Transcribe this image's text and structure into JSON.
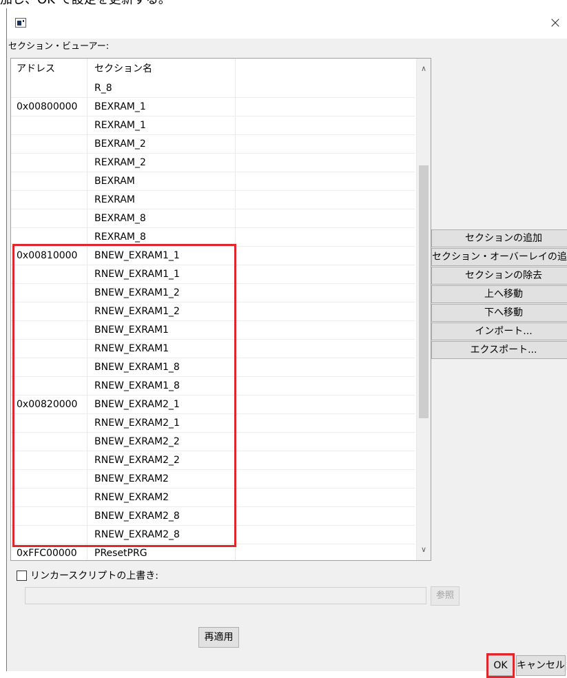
{
  "page_text": "加し、OK で設定を更新する。",
  "dialog": {
    "close_glyph": "×",
    "section_viewer_label": "セクション・ビューアー:"
  },
  "table": {
    "columns": [
      "アドレス",
      "セクション名"
    ],
    "rows": [
      {
        "address": "",
        "name": "R_8"
      },
      {
        "address": "0x00800000",
        "name": "BEXRAM_1"
      },
      {
        "address": "",
        "name": "REXRAM_1"
      },
      {
        "address": "",
        "name": "BEXRAM_2"
      },
      {
        "address": "",
        "name": "REXRAM_2"
      },
      {
        "address": "",
        "name": "BEXRAM"
      },
      {
        "address": "",
        "name": "REXRAM"
      },
      {
        "address": "",
        "name": "BEXRAM_8"
      },
      {
        "address": "",
        "name": "REXRAM_8"
      },
      {
        "address": "0x00810000",
        "name": "BNEW_EXRAM1_1"
      },
      {
        "address": "",
        "name": "RNEW_EXRAM1_1"
      },
      {
        "address": "",
        "name": "BNEW_EXRAM1_2"
      },
      {
        "address": "",
        "name": "RNEW_EXRAM1_2"
      },
      {
        "address": "",
        "name": "BNEW_EXRAM1"
      },
      {
        "address": "",
        "name": "RNEW_EXRAM1"
      },
      {
        "address": "",
        "name": "BNEW_EXRAM1_8"
      },
      {
        "address": "",
        "name": "RNEW_EXRAM1_8"
      },
      {
        "address": "0x00820000",
        "name": "BNEW_EXRAM2_1"
      },
      {
        "address": "",
        "name": "RNEW_EXRAM2_1"
      },
      {
        "address": "",
        "name": "BNEW_EXRAM2_2"
      },
      {
        "address": "",
        "name": "RNEW_EXRAM2_2"
      },
      {
        "address": "",
        "name": "BNEW_EXRAM2"
      },
      {
        "address": "",
        "name": "RNEW_EXRAM2"
      },
      {
        "address": "",
        "name": "BNEW_EXRAM2_8"
      },
      {
        "address": "",
        "name": "RNEW_EXRAM2_8"
      },
      {
        "address": "0xFFC00000",
        "name": "PResetPRG"
      }
    ],
    "scroll_up_glyph": "∧",
    "scroll_down_glyph": "∨"
  },
  "side_buttons": [
    "セクションの追加",
    "セクション・オーバーレイの追加",
    "セクションの除去",
    "上へ移動",
    "下へ移動",
    "インポート...",
    "エクスポート..."
  ],
  "linker": {
    "checkbox_label": "リンカースクリプトの上書き:",
    "checked": false,
    "path_value": "",
    "browse_label": "参照"
  },
  "buttons": {
    "reapply": "再適用",
    "ok": "OK",
    "cancel": "キャンセル"
  },
  "colors": {
    "highlight": "#e0262d",
    "dialog_bg": "#f0f0f0",
    "button_bg": "#e1e1e1"
  }
}
